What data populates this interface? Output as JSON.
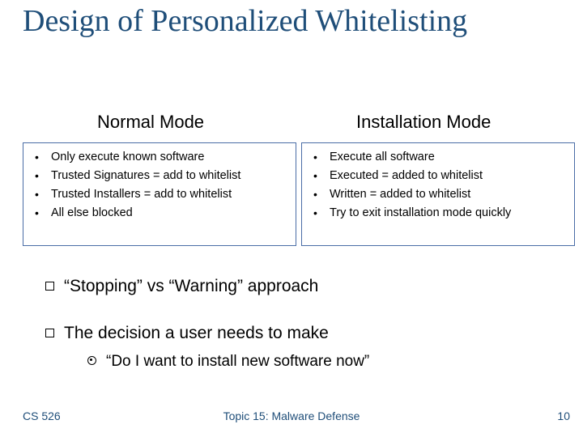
{
  "title": "Design of Personalized Whitelisting",
  "columns": {
    "left": {
      "heading": "Normal Mode",
      "items": [
        "Only execute known software",
        "Trusted Signatures = add to whitelist",
        "Trusted Installers = add to whitelist",
        "All else blocked"
      ]
    },
    "right": {
      "heading": "Installation Mode",
      "items": [
        "Execute all software",
        "Executed = added to whitelist",
        "Written  = added to whitelist",
        "Try to exit installation mode quickly"
      ]
    }
  },
  "outline": {
    "point1": "“Stopping” vs “Warning” approach",
    "point2": "The decision a user needs to make",
    "subpoint": "“Do I want to install new software now”"
  },
  "footer": {
    "left": "CS 526",
    "center": "Topic 15: Malware Defense",
    "right": "10"
  }
}
